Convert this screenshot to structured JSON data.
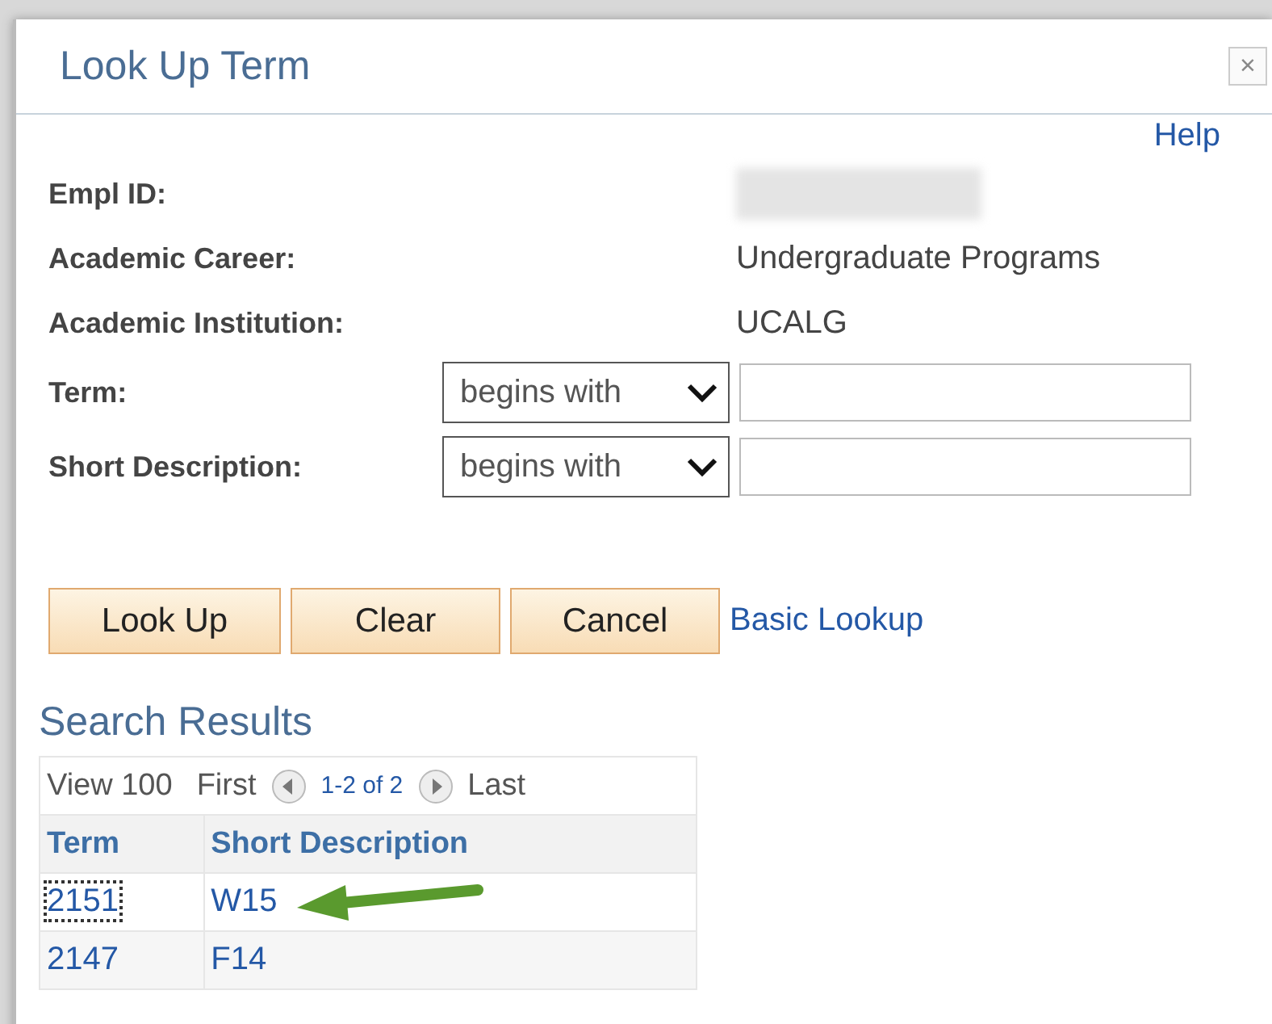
{
  "dialog": {
    "title": "Look Up Term",
    "close": "×"
  },
  "help_link": "Help",
  "info_fields": [
    {
      "label": "Empl ID:",
      "kind": "redacted"
    },
    {
      "label": "Academic Career:",
      "kind": "text",
      "value": "Undergraduate Programs"
    },
    {
      "label": "Academic Institution:",
      "kind": "text",
      "value": "UCALG"
    }
  ],
  "search_fields": [
    {
      "label": "Term:",
      "operator": "begins with"
    },
    {
      "label": "Short Description:",
      "operator": "begins with"
    }
  ],
  "buttons": [
    "Look Up",
    "Clear",
    "Cancel"
  ],
  "basic_lookup_link": "Basic Lookup",
  "results": {
    "title": "Search Results",
    "navigation": {
      "view_all": "View 100",
      "first": "First",
      "range": "1-2 of 2",
      "last": "Last"
    },
    "columns": [
      "Term",
      "Short Description"
    ],
    "rows": [
      {
        "cells": [
          "2151",
          "W15"
        ],
        "focused": true,
        "arrow": true
      },
      {
        "cells": [
          "2147",
          "F14"
        ],
        "focused": false,
        "arrow": false
      }
    ]
  }
}
